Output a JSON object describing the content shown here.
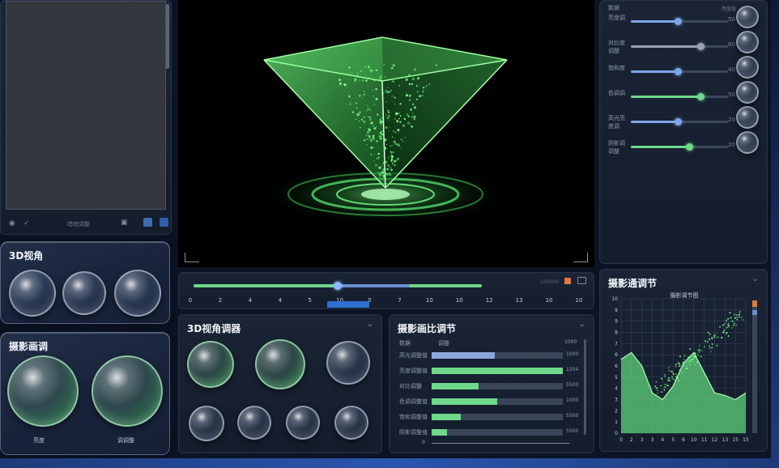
{
  "panels": {
    "view3d": {
      "title": "3D视角"
    },
    "camera": {
      "title": "摄影画调"
    },
    "view3d_adjust": {
      "title": "3D视角调器"
    },
    "render_adjust": {
      "title": "摄影画比调节"
    },
    "camera_adjust": {
      "title": "摄影通调节"
    }
  },
  "camera_bubble_labels": [
    "亮度",
    "调调整"
  ],
  "texture_toolbar": {
    "label": "暗暗调整"
  },
  "sliders_header": {
    "left": "数据",
    "right": "亮度值"
  },
  "sliders": [
    {
      "label": "亮度调",
      "value": 0.48,
      "color": "#7fa6e8",
      "value_text": "50"
    },
    {
      "label": "对比度\n调整",
      "value": 0.72,
      "color": "#9aa3b2",
      "value_text": "60"
    },
    {
      "label": "饱和度",
      "value": 0.48,
      "color": "#7fa6e8",
      "value_text": "40"
    },
    {
      "label": "色调调",
      "value": 0.72,
      "color": "#6fd88a",
      "value_text": "50"
    },
    {
      "label": "高光亮\n度调",
      "value": 0.48,
      "color": "#7fa6e8",
      "value_text": "20"
    },
    {
      "label": "阴影调\n调整",
      "value": 0.6,
      "color": "#6fd88a",
      "value_text": "20"
    }
  ],
  "timeline": {
    "value": 0.5,
    "ticks": [
      "0",
      "2",
      "4",
      "4",
      "5",
      "10",
      "0",
      "7",
      "10",
      "10",
      "12",
      "13",
      "10",
      "10"
    ],
    "right_label": "100000"
  },
  "bar_chart": {
    "header_left": "数据",
    "header_mid": "调整",
    "header_right": "1000",
    "rows": [
      {
        "label": "高光调整值",
        "value": 0.48,
        "color": "#8ea6dc",
        "value_text": "1000"
      },
      {
        "label": "亮度调整值",
        "value": 1.0,
        "color": "#6fd88a",
        "value_text": "1204"
      },
      {
        "label": "对比调整",
        "value": 0.36,
        "color": "#6fd88a",
        "value_text": "5500"
      },
      {
        "label": "色调调整值",
        "value": 0.5,
        "color": "#6fd88a",
        "value_text": "1000"
      },
      {
        "label": "饱和调整值",
        "value": 0.22,
        "color": "#6fd88a",
        "value_text": "5500"
      },
      {
        "label": "阴影调整值",
        "value": 0.12,
        "color": "#6fd88a",
        "value_text": "5500"
      }
    ],
    "axis_zero": "0"
  },
  "chart_data": {
    "type": "area",
    "title": "摄影调节图",
    "x": [
      0,
      1,
      2,
      3,
      4,
      5,
      6,
      7,
      8,
      9,
      10,
      11,
      12
    ],
    "y": [
      0.55,
      0.6,
      0.5,
      0.3,
      0.25,
      0.35,
      0.52,
      0.6,
      0.45,
      0.3,
      0.28,
      0.25,
      0.3
    ],
    "xticks": [
      "0",
      "2",
      "3",
      "3",
      "4",
      "5",
      "6",
      "10",
      "11",
      "12",
      "13",
      "15",
      "15"
    ],
    "yticks": [
      "10",
      "9",
      "9",
      "8",
      "7",
      "6",
      "6",
      "5",
      "4",
      "3",
      "2",
      "1",
      "0"
    ],
    "ylim": [
      0,
      1
    ],
    "grid": true
  },
  "colors": {
    "accent_green": "#6fd88a",
    "accent_blue": "#7fa6e8",
    "orange": "#e07a3a"
  }
}
